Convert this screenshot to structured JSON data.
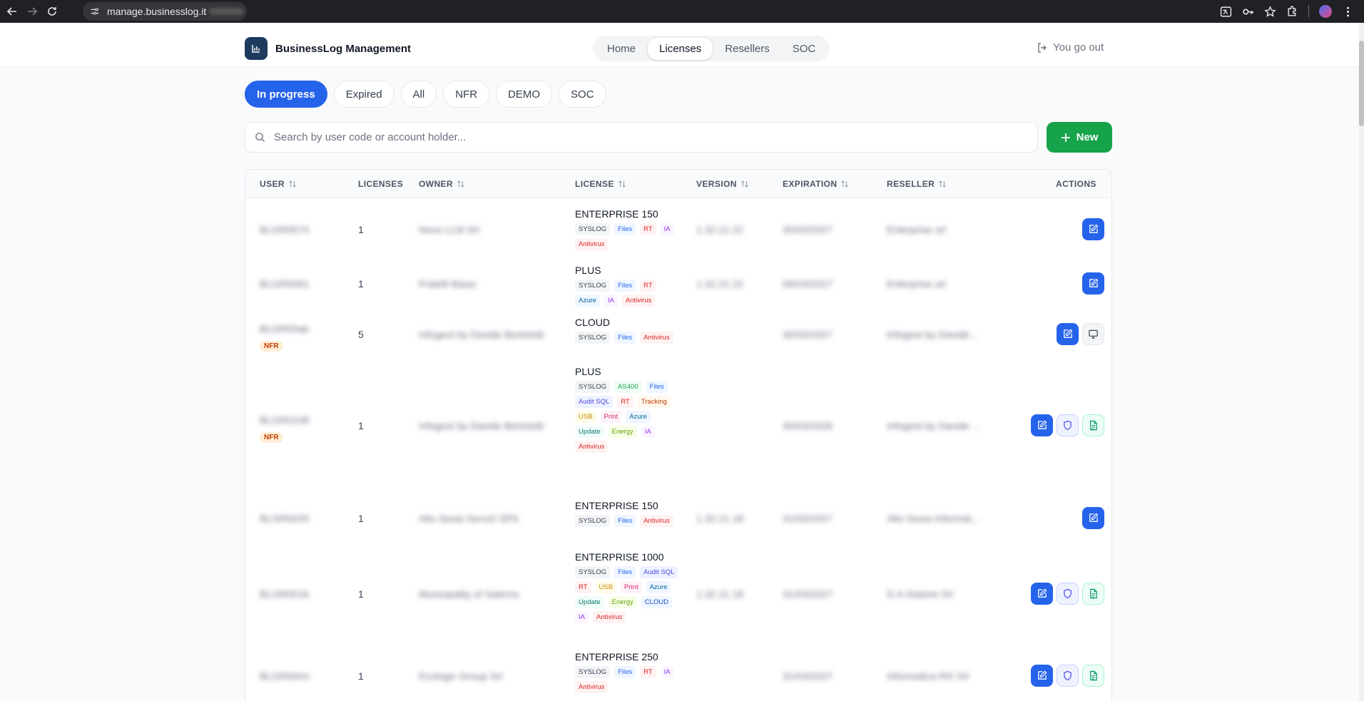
{
  "browser": {
    "url": "manage.businesslog.it"
  },
  "app": {
    "name": "BusinessLog Management",
    "nav": [
      "Home",
      "Licenses",
      "Resellers",
      "SOC"
    ],
    "active_nav": "Licenses",
    "logout_label": "You go out"
  },
  "filters": {
    "tabs": [
      "In progress",
      "Expired",
      "All",
      "NFR",
      "DEMO",
      "SOC"
    ],
    "active": "In progress"
  },
  "search": {
    "placeholder": "Search by user code or account holder...",
    "value": ""
  },
  "new_button": "New",
  "table": {
    "headers": {
      "user": "USER",
      "licenses": "LICENSES",
      "owner": "OWNER",
      "license": "LICENSE",
      "version": "VERSION",
      "expiration": "EXPIRATION",
      "reseller": "RESELLER",
      "actions": "ACTIONS"
    },
    "rows": [
      {
        "licenses": "1",
        "nfr": "",
        "license": "ENTERPRISE 150",
        "tags": [
          "SYSLOG",
          "Files",
          "RT",
          "IA",
          "Antivirus"
        ],
        "actions": [
          "edit"
        ]
      },
      {
        "licenses": "1",
        "nfr": "",
        "license": "PLUS",
        "tags": [
          "SYSLOG",
          "Files",
          "RT",
          "Azure",
          "IA",
          "Antivirus"
        ],
        "actions": [
          "edit"
        ]
      },
      {
        "licenses": "5",
        "nfr": "NFR",
        "license": "CLOUD",
        "tags": [
          "SYSLOG",
          "Files",
          "Antivirus"
        ],
        "actions": [
          "edit",
          "monitor"
        ]
      },
      {
        "licenses": "1",
        "nfr": "NFR",
        "license": "PLUS",
        "tags": [
          "SYSLOG",
          "AS400",
          "Files",
          "Audit SQL",
          "RT",
          "Tracking",
          "USB",
          "Print",
          "Azure",
          "Update",
          "Energy",
          "IA",
          "Antivirus"
        ],
        "actions": [
          "edit",
          "shield",
          "doc"
        ]
      },
      {
        "licenses": "1",
        "nfr": "",
        "license": "ENTERPRISE 150",
        "tags": [
          "SYSLOG",
          "Files",
          "Antivirus"
        ],
        "actions": [
          "edit"
        ]
      },
      {
        "licenses": "1",
        "nfr": "",
        "license": "ENTERPRISE 1000",
        "tags": [
          "SYSLOG",
          "Files",
          "Audit SQL",
          "RT",
          "USB",
          "Print",
          "Azure",
          "Update",
          "Energy",
          "CLOUD",
          "IA",
          "Antivirus"
        ],
        "actions": [
          "edit",
          "shield",
          "doc"
        ]
      },
      {
        "licenses": "1",
        "nfr": "",
        "license": "ENTERPRISE 250",
        "tags": [
          "SYSLOG",
          "Files",
          "RT",
          "IA",
          "Antivirus"
        ],
        "actions": [
          "edit",
          "shield",
          "doc"
        ]
      }
    ]
  },
  "tag_colors": {
    "SYSLOG": [
      "#f3f4f6",
      "#374151"
    ],
    "Files": [
      "#eff6ff",
      "#2563eb"
    ],
    "RT": [
      "#fef2f2",
      "#dc2626"
    ],
    "IA": [
      "#faf5ff",
      "#9333ea"
    ],
    "Antivirus": [
      "#fef2f2",
      "#dc2626"
    ],
    "Azure": [
      "#eff6ff",
      "#0369a1"
    ],
    "AS400": [
      "#f0fdf4",
      "#16a34a"
    ],
    "Audit SQL": [
      "#eef2ff",
      "#4f46e5"
    ],
    "Tracking": [
      "#fff7ed",
      "#c2410c"
    ],
    "USB": [
      "#fefce8",
      "#ca8a04"
    ],
    "Print": [
      "#fdf2f8",
      "#db2777"
    ],
    "Update": [
      "#f0fdfa",
      "#0f766e"
    ],
    "Energy": [
      "#f7fee7",
      "#65a30d"
    ],
    "CLOUD": [
      "#eff6ff",
      "#1d4ed8"
    ]
  },
  "colors": {
    "primary": "#2563eb",
    "success": "#16a34a",
    "brand": "#1e3a5f"
  }
}
